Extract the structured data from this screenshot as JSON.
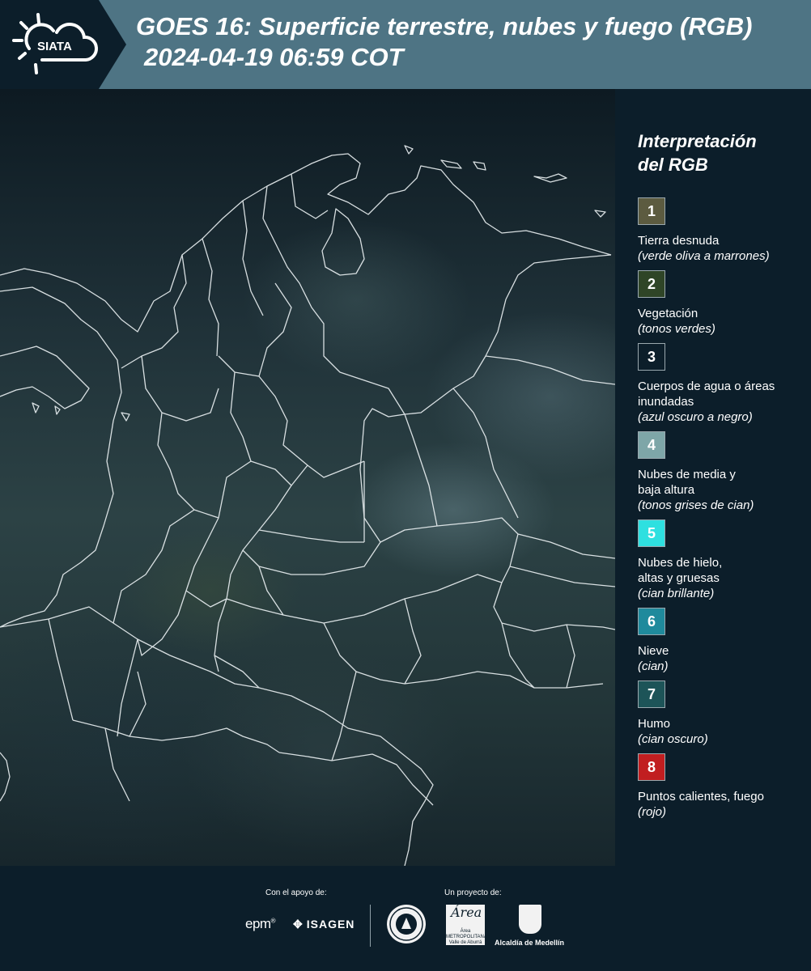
{
  "header": {
    "logo_text": "SIATA",
    "title_line1": "GOES 16: Superficie terrestre, nubes y fuego (RGB)",
    "title_line2": "2024-04-19 06:59 COT"
  },
  "legend": {
    "title_line1": "Interpretación",
    "title_line2": "del RGB",
    "items": [
      {
        "number": "1",
        "label": "Tierra desnuda",
        "sub": "(verde oliva a marrones)",
        "color": "#5c5b40"
      },
      {
        "number": "2",
        "label": "Vegetación",
        "sub": "(tonos verdes)",
        "color": "#2f4527"
      },
      {
        "number": "3",
        "label": "Cuerpos de agua o áreas inundadas",
        "sub": "(azul oscuro a negro)",
        "color": "#0c1e2a"
      },
      {
        "number": "4",
        "label": "Nubes de media y baja altura",
        "sub": "(tonos grises de cian)",
        "color": "#7ea6a8"
      },
      {
        "number": "5",
        "label": "Nubes de hielo, altas y gruesas",
        "sub": "(cian brillante)",
        "color": "#2ee0e0"
      },
      {
        "number": "6",
        "label": "Nieve",
        "sub": "(cian)",
        "color": "#1f8a9c"
      },
      {
        "number": "7",
        "label": "Humo",
        "sub": "(cian oscuro)",
        "color": "#1d5458"
      },
      {
        "number": "8",
        "label": "Puntos calientes, fuego",
        "sub": "(rojo)",
        "color": "#c11e20"
      }
    ]
  },
  "footer": {
    "support_label": "Con el apoyo de:",
    "project_label": "Un proyecto de:",
    "sponsor1": "epm",
    "sponsor2": "ISAGEN",
    "partner_amva": "Área METROPOLITANA Valle de Aburrá",
    "partner_alcaldia": "Alcaldía de Medellín"
  }
}
